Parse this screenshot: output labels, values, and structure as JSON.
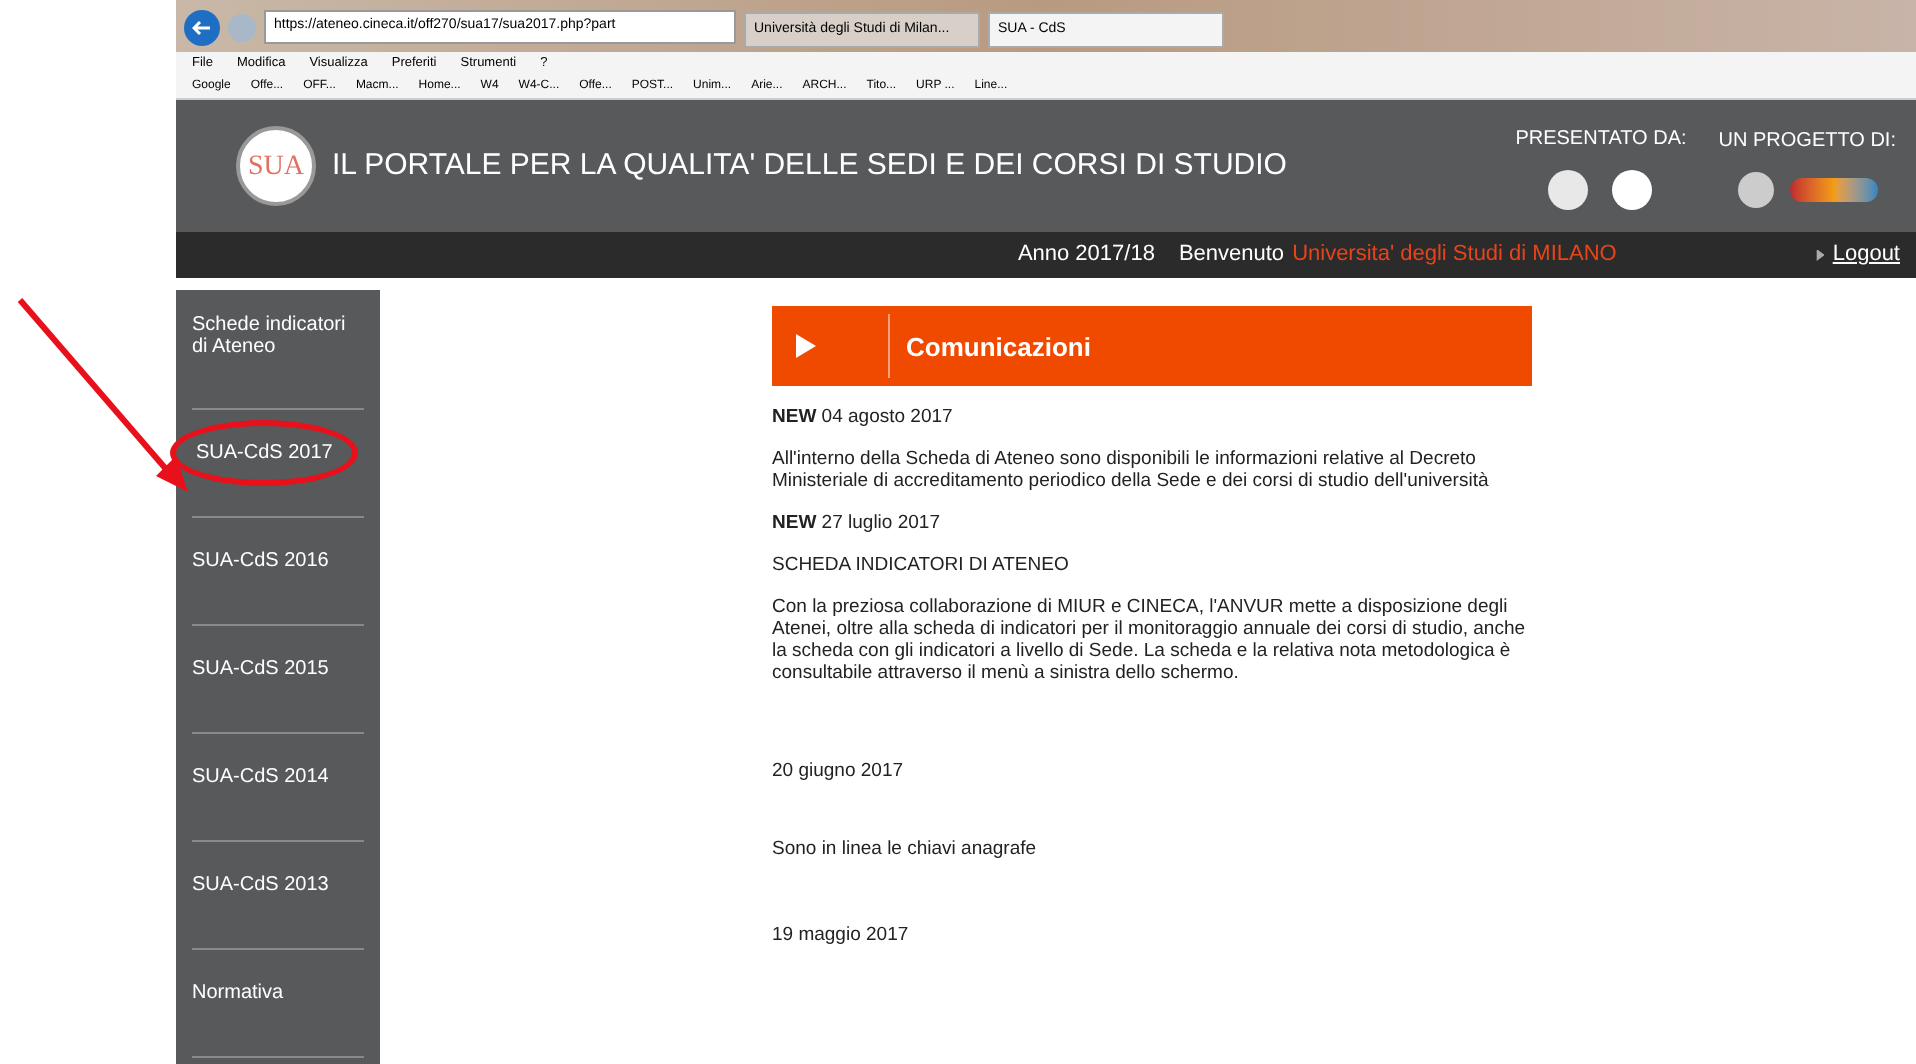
{
  "browser": {
    "address": "https://ateneo.cineca.it/off270/sua17/sua2017.php?part",
    "tabs": [
      {
        "label": "Università degli Studi di Milan...",
        "selected": false
      },
      {
        "label": "SUA - CdS",
        "selected": true
      }
    ],
    "menu": [
      "File",
      "Modifica",
      "Visualizza",
      "Preferiti",
      "Strumenti",
      "?"
    ],
    "bookmarks": [
      "Google",
      "Offe...",
      "OFF...",
      "Macm...",
      "Home...",
      "W4",
      "W4-C...",
      "Offe...",
      "POST...",
      "Unim...",
      "Arie...",
      "ARCH...",
      "Tito...",
      "URP ...",
      "Line..."
    ]
  },
  "header": {
    "logo": "SUA",
    "title": "IL PORTALE PER LA QUALITA' DELLE SEDI E DEI CORSI DI STUDIO",
    "presented_by": "PRESENTATO DA:",
    "project_by": "UN PROGETTO DI:"
  },
  "user_bar": {
    "year": "Anno 2017/18",
    "welcome": "Benvenuto",
    "university": "Universita' degli Studi di MILANO",
    "logout": "Logout"
  },
  "sidebar": {
    "items": [
      {
        "label": "Schede indicatori di Ateneo",
        "highlighted": false
      },
      {
        "label": "SUA-CdS 2017",
        "highlighted": true
      },
      {
        "label": "SUA-CdS 2016",
        "highlighted": false
      },
      {
        "label": "SUA-CdS 2015",
        "highlighted": false
      },
      {
        "label": "SUA-CdS 2014",
        "highlighted": false
      },
      {
        "label": "SUA-CdS 2013",
        "highlighted": false
      },
      {
        "label": "Normativa",
        "highlighted": false
      }
    ]
  },
  "news": {
    "title": "Comunicazioni",
    "items": [
      {
        "kind": "date",
        "text": "**NEW** 04 agosto 2017"
      },
      {
        "kind": "text",
        "text": "All'interno della Scheda di Ateneo sono disponibili le informazioni relative al Decreto Ministeriale di accreditamento periodico della Sede e dei corsi di studio dell'università"
      },
      {
        "kind": "date",
        "text": "**NEW** 27 luglio 2017"
      },
      {
        "kind": "text",
        "text": "SCHEDA INDICATORI DI ATENEO"
      },
      {
        "kind": "text",
        "text": "Con la preziosa collaborazione di MIUR e CINECA, l'ANVUR mette a disposizione degli Atenei, oltre alla scheda di indicatori per il monitoraggio annuale dei corsi di studio, anche la scheda con gli indicatori a livello di Sede. La scheda e la relativa nota metodologica è consultabile attraverso il menù a sinistra dello schermo."
      },
      {
        "kind": "gap"
      },
      {
        "kind": "date",
        "text": "20 giugno 2017"
      },
      {
        "kind": "spaced",
        "text": "Sono in linea le chiavi anagrafe"
      },
      {
        "kind": "spaced",
        "text": "19 maggio 2017"
      }
    ]
  }
}
